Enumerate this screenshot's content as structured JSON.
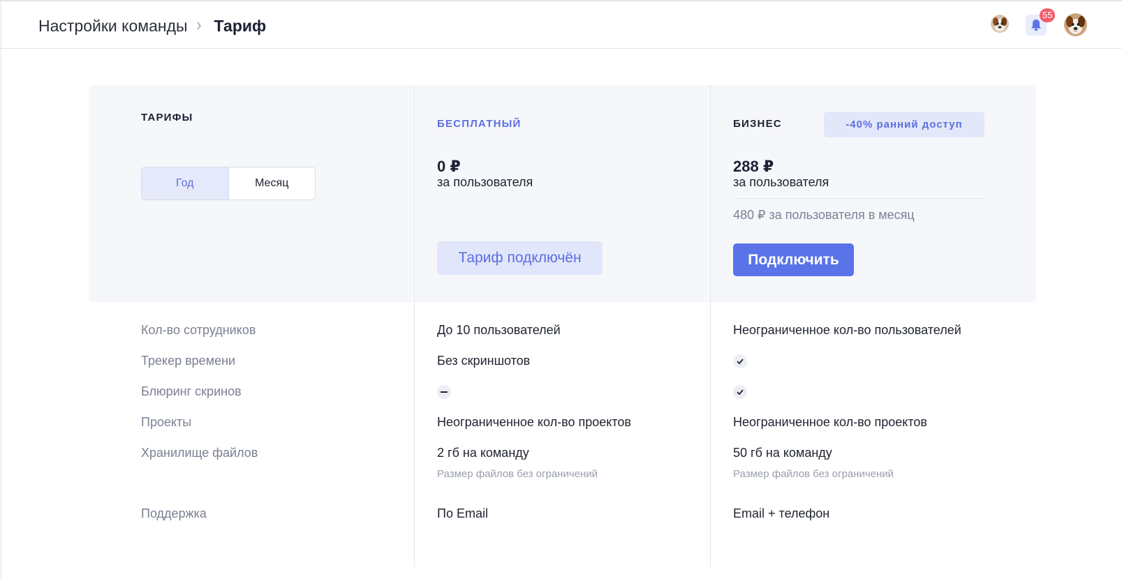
{
  "header": {
    "breadcrumb_parent": "Настройки команды",
    "breadcrumb_current": "Тариф",
    "notifications_count": "55"
  },
  "plans": {
    "title": "Тарифы",
    "period_toggle": {
      "year": "Год",
      "month": "Месяц",
      "selected": "year"
    },
    "free": {
      "name": "Бесплатный",
      "price": "0 ₽",
      "per_user": "за пользователя",
      "button": "Тариф подключён"
    },
    "business": {
      "name": "Бизнес",
      "badge": "-40% ранний доступ",
      "price": "288 ₽",
      "per_user": "за пользователя",
      "monthly_note": "480 ₽ за пользователя в месяц",
      "button": "Подключить"
    }
  },
  "features": [
    {
      "label": "Кол-во сотрудников",
      "free": "До 10 пользователей",
      "business": "Неограниченное кол-во пользователей"
    },
    {
      "label": "Трекер времени",
      "free": "Без скриншотов",
      "business_icon": "check-icon"
    },
    {
      "label": "Блюринг скринов",
      "free_icon": "minus-icon",
      "business_icon": "check-icon"
    },
    {
      "label": "Проекты",
      "free": "Неограниченное кол-во проектов",
      "business": "Неограниченное кол-во проектов"
    },
    {
      "label": "Хранилище файлов",
      "free": "2 гб на команду",
      "free_note": "Размер файлов без ограничений",
      "business": "50 гб на команду",
      "business_note": "Размер файлов без ограничений"
    },
    {
      "label": "Поддержка",
      "free": "По Email",
      "business": "Email + телефон"
    }
  ],
  "colors": {
    "accent": "#5b73e8",
    "accent_light": "#e3e7fa",
    "panel_bg": "#f6f7fb",
    "badge_red": "#f25f6b"
  }
}
